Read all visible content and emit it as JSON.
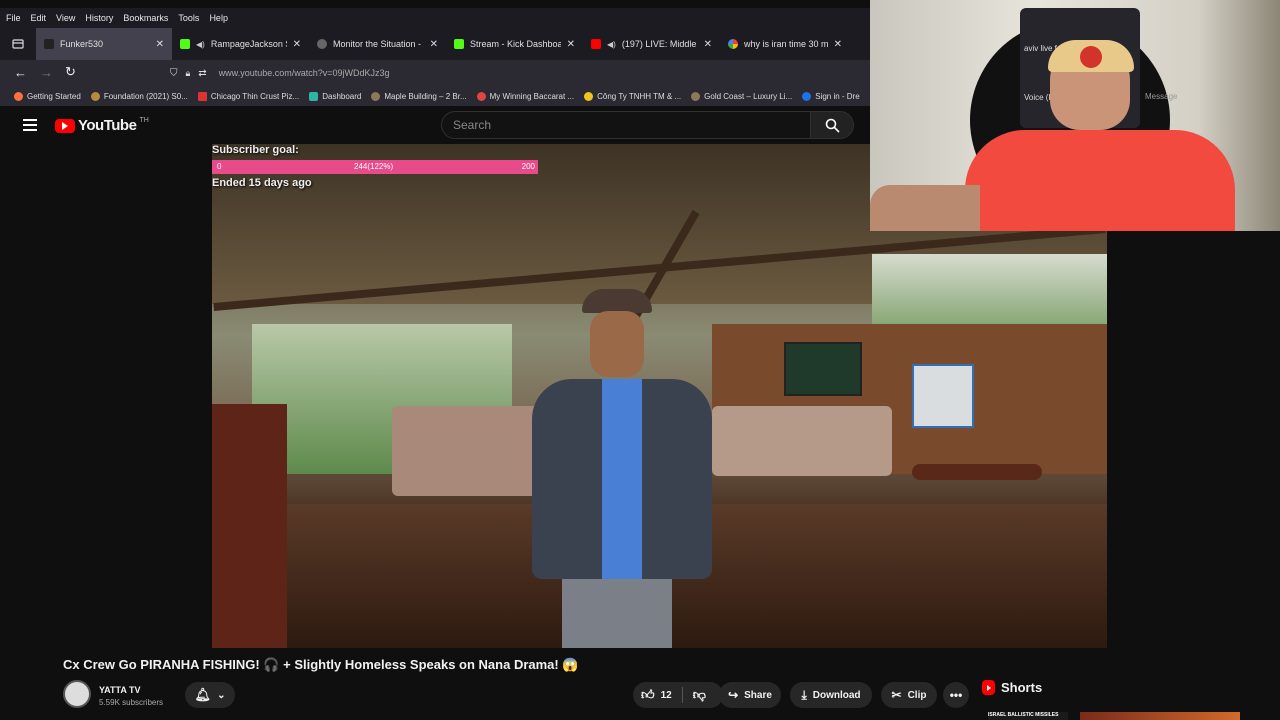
{
  "menubar": [
    "File",
    "Edit",
    "View",
    "History",
    "Bookmarks",
    "Tools",
    "Help"
  ],
  "tabs": [
    {
      "label": "Funker530",
      "color": "#222222"
    },
    {
      "label": "RampageJackson Strea",
      "color": "#53fc18"
    },
    {
      "label": "Monitor the Situation - 24",
      "color": "#666666"
    },
    {
      "label": "Stream - Kick Dashboard",
      "color": "#53fc18"
    },
    {
      "label": "(197) LIVE: Middle East",
      "color": "#ff0000"
    },
    {
      "label": "why is iran time 30 minute",
      "color": "#4285f4"
    }
  ],
  "url": "www.youtube.com/watch?v=09jWDdKJz3g",
  "bookmarks": [
    {
      "label": "Getting Started",
      "color": "#ff7139"
    },
    {
      "label": "Foundation (2021) S0...",
      "color": "#b58b3c"
    },
    {
      "label": "Chicago Thin Crust Piz...",
      "color": "#d33"
    },
    {
      "label": "Dashboard",
      "color": "#2fb5a4"
    },
    {
      "label": "Maple Building – 2 Br...",
      "color": "#8a7a55"
    },
    {
      "label": "My Winning Baccarat ...",
      "color": "#e04545"
    },
    {
      "label": "Công Ty TNHH TM & ...",
      "color": "#f0c419"
    },
    {
      "label": "Gold Coast – Luxury Li...",
      "color": "#8a7a55"
    },
    {
      "label": "Sign in - Dre",
      "color": "#1a73e8"
    }
  ],
  "youtube": {
    "logo_text": "YouTube",
    "logo_suffix": "TH",
    "search_placeholder": "Search"
  },
  "overlay": {
    "goal_label": "Subscriber goal:",
    "goal_start": "0",
    "goal_progress": "244(122%)",
    "goal_target": "200",
    "ended": "Ended 15 days ago"
  },
  "webcam_overlay": {
    "visible_text_1": "aviv live fe",
    "visible_text_2": "Voice (Kore",
    "visible_text_3": "Message"
  },
  "video": {
    "title": "Cx Crew Go PIRANHA FISHING! 🎧 + Slightly Homeless Speaks on Nana Drama! 😱",
    "channel": "YATTA TV",
    "subscribers": "5.59K subscribers",
    "likes": "12",
    "share": "Share",
    "download": "Download",
    "clip": "Clip"
  },
  "shorts_label": "Shorts",
  "shorts_banner": "ISRAEL BALLISTIC MISSILES"
}
